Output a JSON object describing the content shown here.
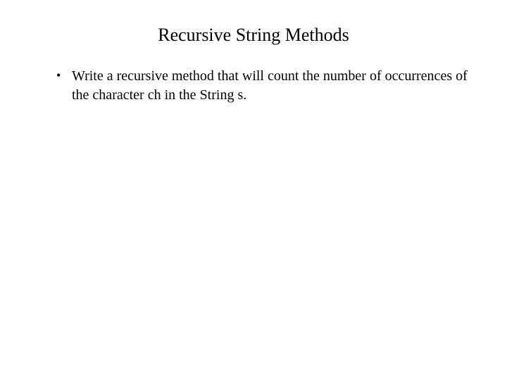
{
  "slide": {
    "title": "Recursive String Methods",
    "bullets": [
      "Write a recursive method that will count the number of occurrences of the character ch in the String s."
    ]
  }
}
